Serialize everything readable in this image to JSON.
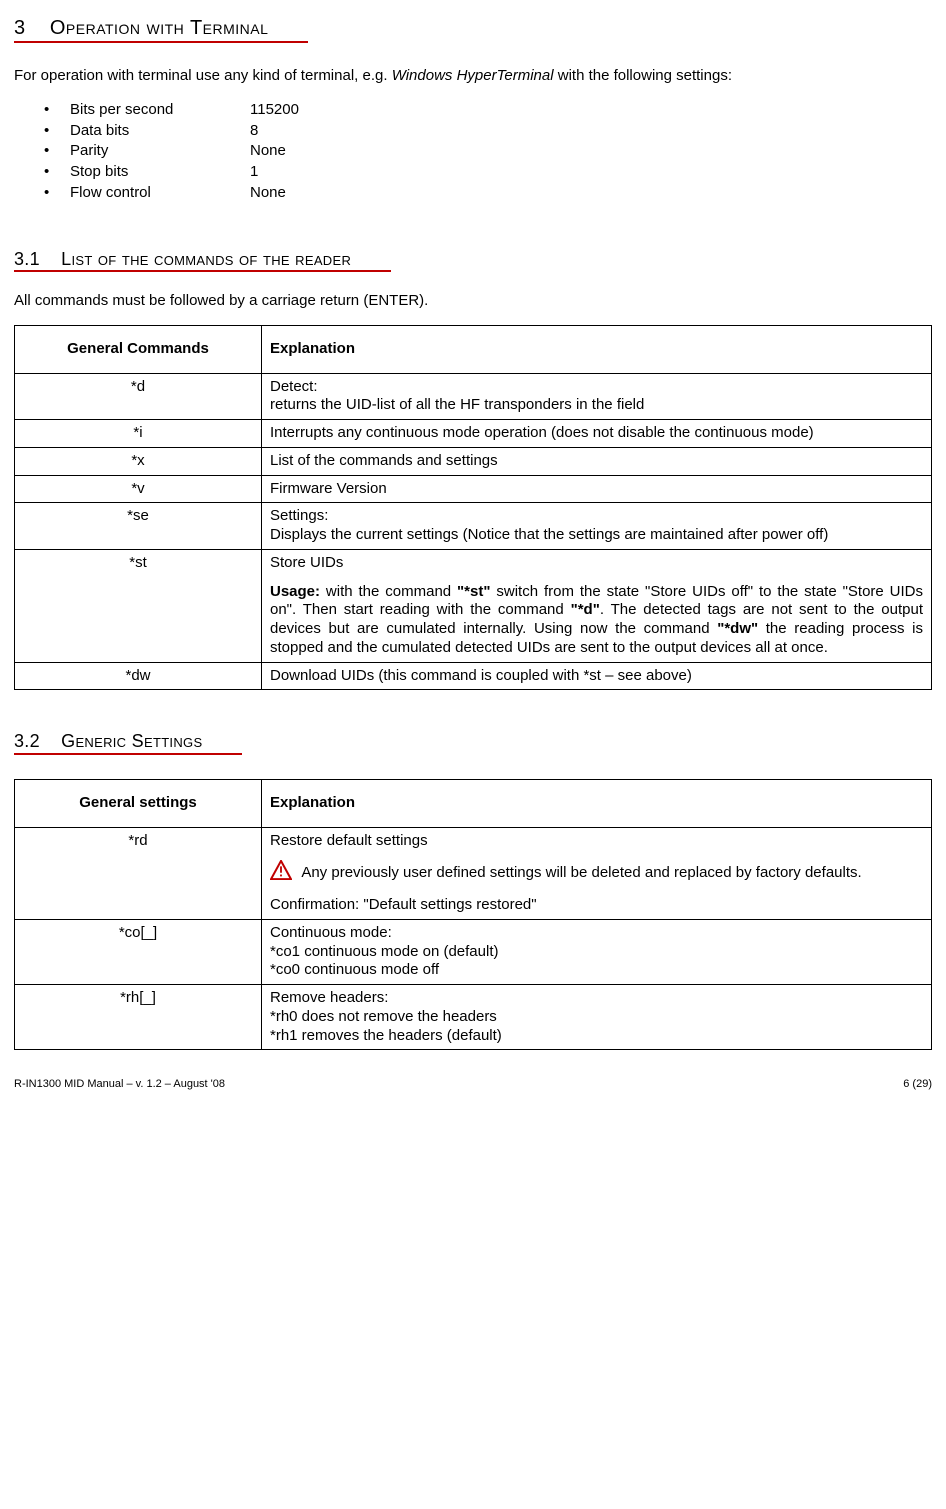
{
  "section3": {
    "number": "3",
    "title": "Operation with Terminal",
    "intro_prefix": "For operation with terminal use any kind of terminal, e.g. ",
    "intro_em": "Windows HyperTerminal",
    "intro_suffix": " with the following settings:",
    "settings": [
      {
        "label": "Bits per second",
        "value": "115200"
      },
      {
        "label": "Data bits",
        "value": "8"
      },
      {
        "label": "Parity",
        "value": "None"
      },
      {
        "label": "Stop bits",
        "value": "1"
      },
      {
        "label": "Flow control",
        "value": "None"
      }
    ]
  },
  "section31": {
    "number": "3.1",
    "title": "List of the commands of the reader",
    "intro": "All commands must be followed by a carriage return (ENTER).",
    "table": {
      "header_cmd": "General Commands",
      "header_exp": "Explanation",
      "rows": {
        "d": {
          "cmd": "*d",
          "line1": "Detect:",
          "line2": "returns the UID-list of all the HF transponders in the field"
        },
        "i": {
          "cmd": "*i",
          "text": " Interrupts any continuous mode operation (does not disable the continuous mode)"
        },
        "x": {
          "cmd": "*x",
          "text": "List of the commands and settings"
        },
        "v": {
          "cmd": "*v",
          "text": "Firmware Version"
        },
        "se": {
          "cmd": "*se",
          "line1": "Settings:",
          "line2": "Displays the current settings (Notice that the settings are maintained after power off)"
        },
        "st": {
          "cmd": "*st",
          "title": "Store UIDs",
          "usage_label": "Usage:",
          "usage_1": " with the command ",
          "usage_b1": "\"*st\"",
          "usage_2": " switch from the state \"Store UIDs off\" to the state \"Store UIDs on\".  Then start reading with the command ",
          "usage_b2": "\"*d\"",
          "usage_3": ".  The detected tags are not sent to the output devices but are cumulated internally.  Using now the command ",
          "usage_b3": "\"*dw\"",
          "usage_4": " the reading process is stopped and the cumulated detected UIDs are sent to the output devices all at once."
        },
        "dw": {
          "cmd": "*dw",
          "text": "Download UIDs (this command is coupled with *st – see above)"
        }
      }
    }
  },
  "section32": {
    "number": "3.2",
    "title": "Generic Settings",
    "table": {
      "header_cmd": "General settings",
      "header_exp": "Explanation",
      "rows": {
        "rd": {
          "cmd": "*rd",
          "line1": "Restore default settings",
          "warn": " Any previously user defined settings will be deleted and replaced by factory defaults.",
          "confirm": "Confirmation: \"Default settings restored\""
        },
        "co": {
          "cmd": "*co[_]",
          "line1": "Continuous mode:",
          "line2": "*co1 continuous  mode on (default)",
          "line3": "*co0 continuous mode off"
        },
        "rh": {
          "cmd": "*rh[_]",
          "line1": "Remove headers:",
          "line2": "*rh0  does not remove the headers",
          "line3": "*rh1 removes the headers (default)"
        }
      }
    }
  },
  "footer": {
    "left": "R-IN1300 MID Manual  – v. 1.2 – August '08",
    "right": "6 (29)"
  }
}
